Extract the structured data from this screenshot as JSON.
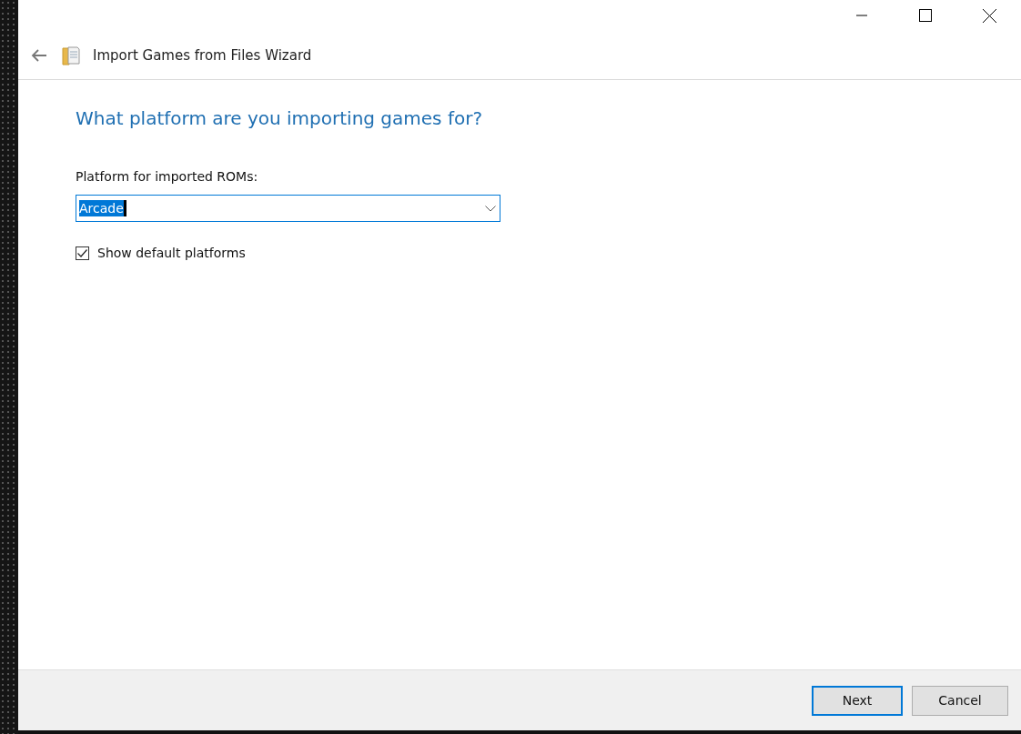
{
  "window": {
    "title": "Import Games from Files Wizard"
  },
  "heading": "What platform are you importing games for?",
  "platform": {
    "label": "Platform for imported ROMs:",
    "value": "Arcade",
    "focused": true
  },
  "show_default": {
    "label": "Show default platforms",
    "checked": true
  },
  "buttons": [
    {
      "label": "Next",
      "default": true
    },
    {
      "label": "Cancel",
      "default": false
    }
  ]
}
